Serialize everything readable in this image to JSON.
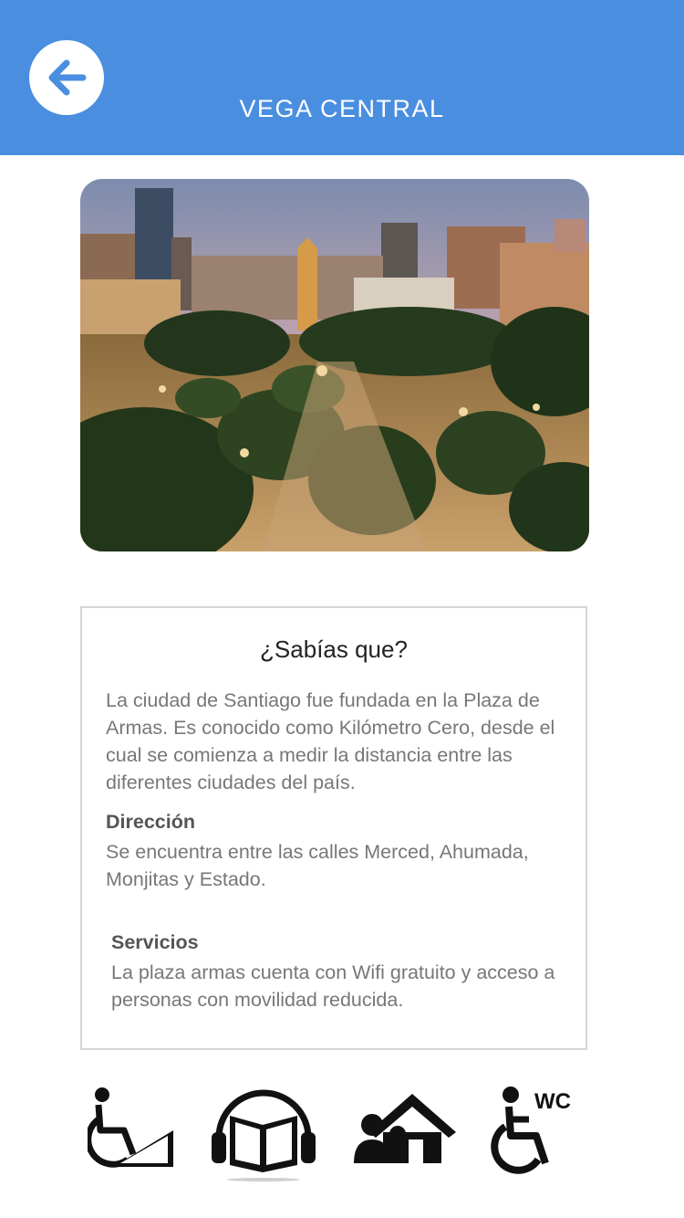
{
  "header": {
    "title": "VEGA CENTRAL",
    "background": "#4a8ee0",
    "back_icon": "arrow-left-icon"
  },
  "photo": {
    "alt": "Plaza de Armas, Santiago"
  },
  "info": {
    "title": "¿Sabías que?",
    "description": "La ciudad de Santiago fue fundada en la Plaza de Armas. Es conocido como Kilómetro Cero, desde el cual se comienza a medir la distancia entre las diferentes ciudades del país.",
    "address_heading": "Dirección",
    "address_text": "Se encuentra entre las calles Merced, Ahumada, Monjitas y Estado.",
    "services_heading": "Servicios",
    "services_text": "La plaza armas cuenta con Wifi gratuito y acceso a personas con movilidad reducida."
  },
  "service_icons": [
    {
      "name": "wheelchair-ramp-icon"
    },
    {
      "name": "audio-guide-icon"
    },
    {
      "name": "family-home-icon"
    },
    {
      "name": "accessible-wc-icon",
      "label": "WC"
    }
  ]
}
